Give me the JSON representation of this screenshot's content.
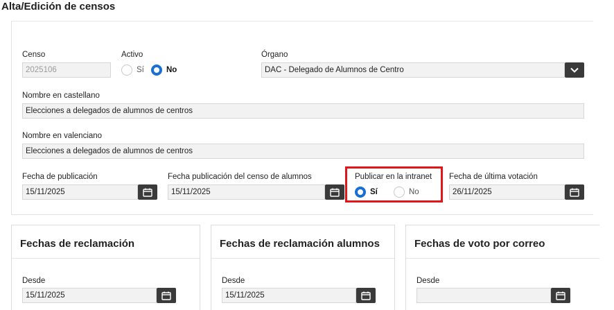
{
  "page": {
    "title": "Alta/Edición de censos"
  },
  "general": {
    "censo_label": "Censo",
    "censo_value": "2025106",
    "activo_label": "Activo",
    "activo_options": [
      "Sí",
      "No"
    ],
    "activo_selected": "No",
    "organo_label": "Órgano",
    "organo_value": "DAC - Delegado de Alumnos de Centro",
    "nombre_cast_label": "Nombre en castellano",
    "nombre_cast_value": "Elecciones a delegados de alumnos de centros",
    "nombre_val_label": "Nombre en valenciano",
    "nombre_val_value": "Elecciones a delegados de alumnos de centros",
    "fecha_pub_label": "Fecha de publicación",
    "fecha_pub_value": "15/11/2025",
    "fecha_pub_censo_label": "Fecha publicación del censo de alumnos",
    "fecha_pub_censo_value": "15/11/2025",
    "publicar_label": "Publicar en la intranet",
    "publicar_options": [
      "Sí",
      "No"
    ],
    "publicar_selected": "Sí",
    "fecha_ult_vot_label": "Fecha de última votación",
    "fecha_ult_vot_value": "26/11/2025"
  },
  "sections": {
    "reclamacion": {
      "title": "Fechas de reclamación",
      "desde_label": "Desde",
      "desde_value": "15/11/2025"
    },
    "reclamacion_alumnos": {
      "title": "Fechas de reclamación alumnos",
      "desde_label": "Desde",
      "desde_value": "15/11/2025"
    },
    "voto_correo": {
      "title": "Fechas de voto por correo",
      "desde_label": "Desde",
      "desde_value": ""
    }
  },
  "colors": {
    "accent": "#1a6fd6",
    "highlight": "#e0161b",
    "button_dark": "#3a3a3a"
  }
}
